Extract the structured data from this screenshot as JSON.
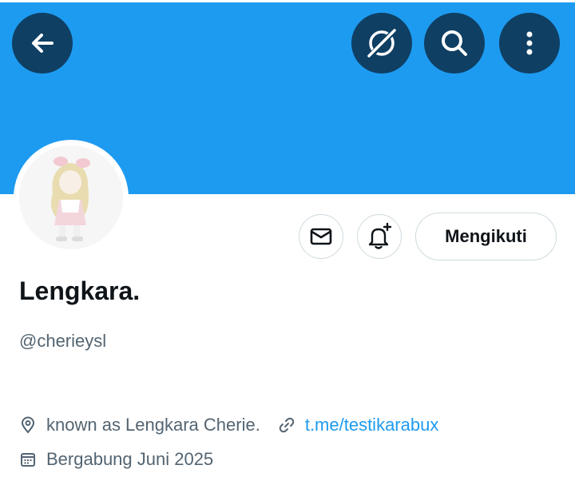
{
  "header": {
    "back_icon": "arrow-left-icon",
    "grok_icon": "grok-icon",
    "search_icon": "search-icon",
    "more_icon": "more-vertical-icon",
    "banner_color": "#1d9bf0",
    "button_color": "#0f3f63"
  },
  "profile": {
    "display_name": "Lengkara.",
    "handle": "@cherieysl",
    "bio_location": "known as Lengkara Cherie.",
    "website": "t.me/testikarabux",
    "joined": "Bergabung Juni 2025"
  },
  "actions": {
    "message_icon": "envelope-icon",
    "notify_icon": "bell-plus-icon",
    "follow_label": "Mengikuti"
  },
  "colors": {
    "accent": "#1d9bf0",
    "text_primary": "#0f1419",
    "text_secondary": "#536471",
    "border": "#cfd9de"
  }
}
